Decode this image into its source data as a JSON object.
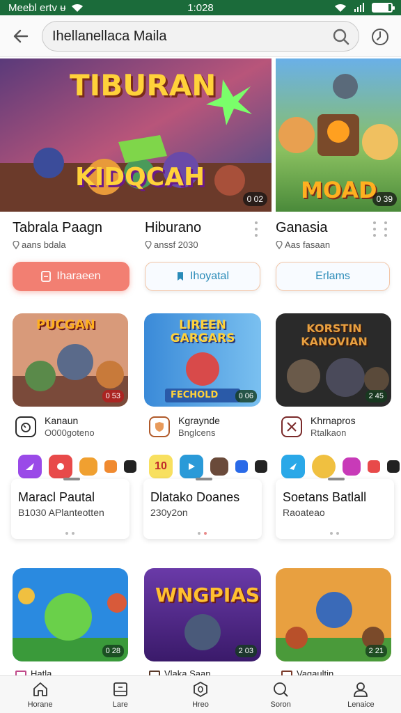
{
  "status": {
    "left_text": "Meebl ertv  ᵾ",
    "time": "1:028",
    "battery_level": 0.85
  },
  "search": {
    "query": "Ihellanellaca Maila"
  },
  "featured": [
    {
      "art_title": "TIBURAN",
      "art_subtitle": "KIDQCAH",
      "badge": "0 02",
      "title": "Tabrala Paagn",
      "sub": "aans bdala"
    },
    {
      "art_title": "",
      "art_subtitle": "",
      "badge": "",
      "title": "Hiburano",
      "sub": "anssf 2030"
    },
    {
      "art_title": "",
      "art_subtitle": "MOAD",
      "badge": "0 39",
      "title": "Ganasia",
      "sub": "Aas fasaan"
    }
  ],
  "tags": [
    {
      "label": "Iharaeen",
      "style": "pink"
    },
    {
      "label": "Ihoyatal",
      "style": "light"
    },
    {
      "label": "Erlams",
      "style": "light"
    }
  ],
  "games": [
    {
      "art_title": "PUCGAN",
      "badge": "0 53",
      "dev_name": "Kanaun",
      "dev_sub": "O000goteno"
    },
    {
      "art_title": "LIREEN GARGARS",
      "art_sub": "FECHOLD",
      "badge": "0 06",
      "dev_name": "Kgraynde",
      "dev_sub": "Bnglcens"
    },
    {
      "art_title": "KORSTIN KANOVIAN",
      "badge": "2 45",
      "dev_name": "Khrnapros",
      "dev_sub": "Rtalkaon"
    }
  ],
  "cards": [
    {
      "title": "Maracl Pautal",
      "sub": "B1030 APlanteotten"
    },
    {
      "title": "Dlatako Doanes",
      "sub": "230y2on"
    },
    {
      "title": "Soetans Batlall",
      "sub": "Raoateao"
    }
  ],
  "games_row2": [
    {
      "art_title": "",
      "badge": "0 28"
    },
    {
      "art_title": "WNGPIAS",
      "badge": "2 03"
    },
    {
      "art_title": "",
      "badge": "2 21"
    }
  ],
  "peek": [
    "Hatla",
    "Vlaka Saan",
    "Vagaultin"
  ],
  "icons": {
    "row1_badge": "10"
  },
  "nav": [
    {
      "label": "Horane",
      "icon": "home-icon"
    },
    {
      "label": "Lare",
      "icon": "library-icon"
    },
    {
      "label": "Hreo",
      "icon": "store-icon"
    },
    {
      "label": "Soron",
      "icon": "search-icon"
    },
    {
      "label": "Lenaice",
      "icon": "profile-icon"
    }
  ]
}
